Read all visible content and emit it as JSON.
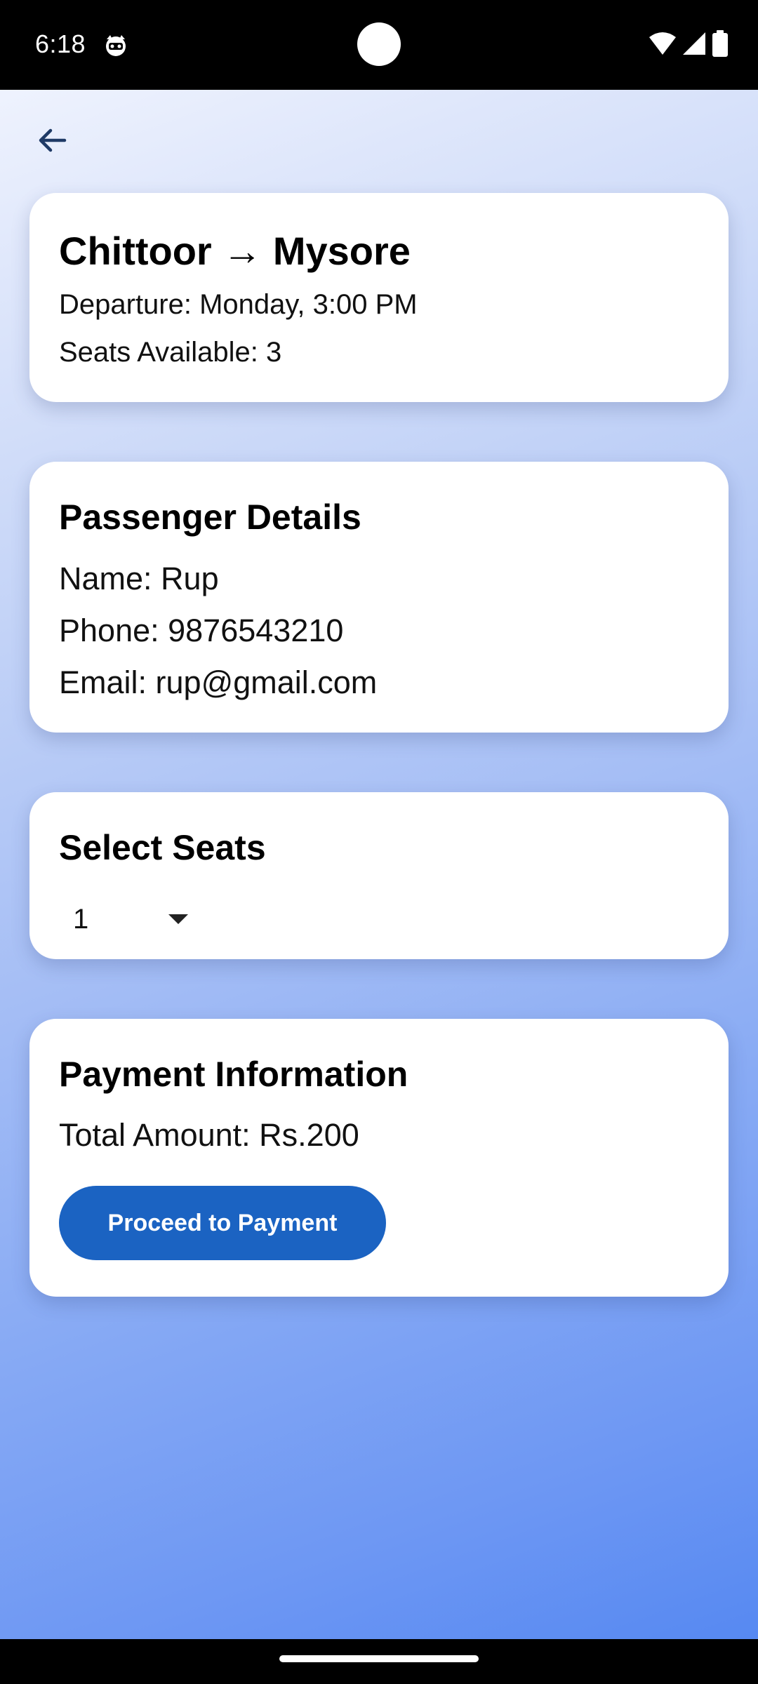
{
  "status_bar": {
    "time": "6:18",
    "notification_icon": "cat-face-icon",
    "icons": [
      "wifi-icon",
      "cellular-signal-icon",
      "battery-icon"
    ]
  },
  "header": {
    "back_icon": "arrow-left-icon"
  },
  "route": {
    "title": "Chittoor → Mysore",
    "departure": "Departure: Monday, 3:00 PM",
    "seats_available": "Seats Available: 3"
  },
  "passenger": {
    "title": "Passenger Details",
    "name": "Name: Rup",
    "phone": "Phone: 9876543210",
    "email": "Email: rup@gmail.com"
  },
  "seats": {
    "title": "Select Seats",
    "selected_value": "1"
  },
  "payment": {
    "title": "Payment Information",
    "total": "Total Amount: Rs.200",
    "button_label": "Proceed to Payment"
  },
  "colors": {
    "primary_button": "#1b63c2",
    "background_top": "#f6f8ff",
    "background_bottom": "#5286f2",
    "card": "#ffffff"
  }
}
